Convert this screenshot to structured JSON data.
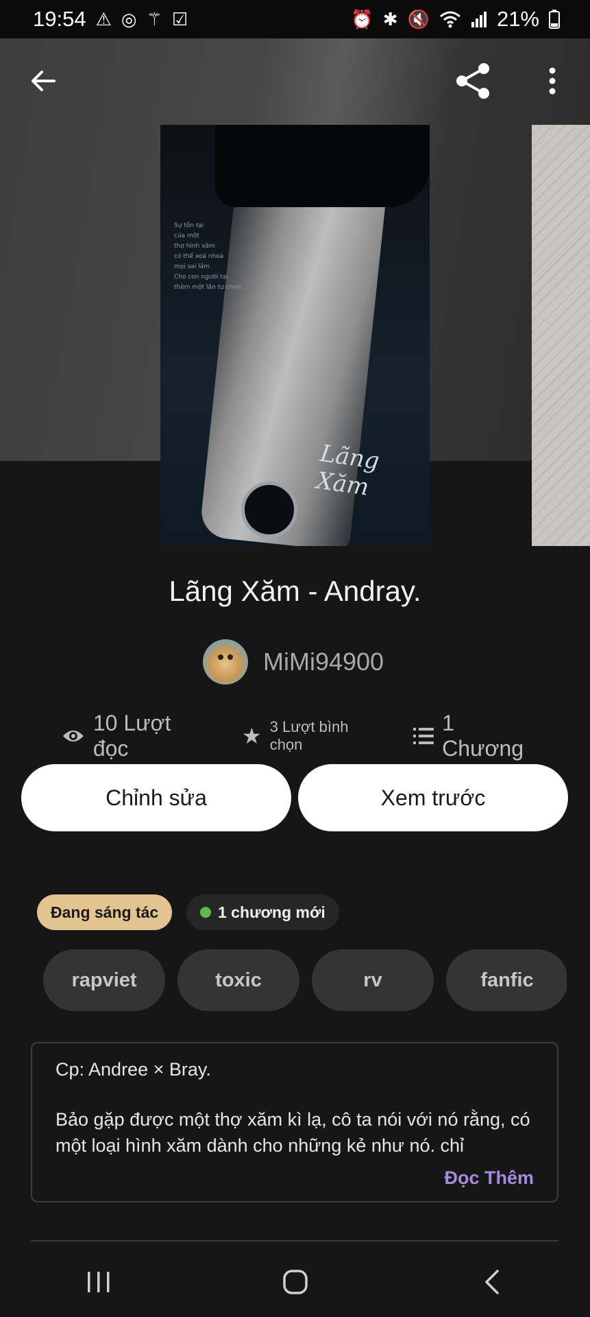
{
  "status_bar": {
    "time": "19:54",
    "battery": "21%",
    "left_icons": [
      "warning-icon",
      "chrome-icon",
      "magic-wand-icon",
      "checkbox-icon"
    ],
    "right_icons": [
      "alarm-icon",
      "bluetooth-icon",
      "mute-icon",
      "wifi-icon",
      "signal-icon",
      "battery-icon"
    ]
  },
  "top_bar": {
    "back_icon": "back-arrow-icon",
    "share_icon": "share-icon",
    "menu_icon": "more-vertical-icon"
  },
  "cover": {
    "text_lines": "Sự tồn tại\ncủa một\nthợ hình xăm\ncó thể xoá nhoà\nmọi sai lầm\nCho con người tại\nthêm một lần tự chọn.",
    "script_title": "Lãng Xăm"
  },
  "story": {
    "title": "Lãng Xăm - Andray.",
    "author": "MiMi94900",
    "stats": {
      "reads": "10 Lượt đọc",
      "votes": "3 Lượt bình chọn",
      "parts": "1 Chương"
    }
  },
  "actions": {
    "edit_label": "Chỉnh sửa",
    "preview_label": "Xem trước"
  },
  "badges": {
    "status": "Đang sáng tác",
    "new_parts": "1 chương mới"
  },
  "tags": [
    "rapviet",
    "toxic",
    "rv",
    "fanfic"
  ],
  "description": {
    "cp": "Cp: Andree × Bray.",
    "body": "Bảo gặp được một thợ xăm kì lạ, cô ta nói với nó rằng, có một loại hình xăm dành cho những kẻ như nó. chỉ",
    "read_more": "Đọc Thêm"
  },
  "colors": {
    "background": "#161616",
    "status_badge": "#e1c48f",
    "new_dot": "#5dbb46",
    "read_more": "#a78be0",
    "tag_bg": "#343434"
  }
}
